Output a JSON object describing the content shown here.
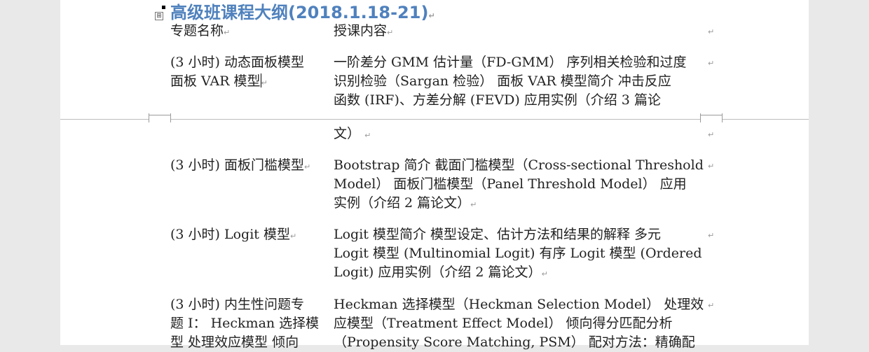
{
  "doc": {
    "heading": "高级班课程大纲(2018.1.18-21)",
    "columns": {
      "topic": "专题名称",
      "content": "授课内容"
    },
    "rows": [
      {
        "topic_lines": [
          "(3 小时) 动态面板模型",
          "面板 VAR 模型"
        ],
        "content_lines": [
          "一阶差分 GMM 估计量（FD-GMM） 序列相关检验和过度",
          "识别检验（Sargan 检验） 面板 VAR 模型简介 冲击反应",
          "函数 (IRF)、方差分解 (FEVD) 应用实例（介绍 3 篇论",
          "文）"
        ]
      },
      {
        "topic_lines": [
          "(3 小时) 面板门槛模型"
        ],
        "content_lines": [
          "Bootstrap 简介 截面门槛模型（Cross-sectional Threshold",
          "Model） 面板门槛模型（Panel Threshold Model） 应用",
          "实例（介绍 2 篇论文）"
        ]
      },
      {
        "topic_lines": [
          "(3 小时) Logit 模型"
        ],
        "content_lines": [
          "Logit 模型简介 模型设定、估计方法和结果的解释 多元",
          "Logit 模型 (Multinomial Logit) 有序 Logit 模型 (Ordered",
          "Logit) 应用实例（介绍 2 篇论文）"
        ]
      },
      {
        "topic_lines": [
          "(3 小时) 内生性问题专",
          "题 I： Heckman 选择模",
          "型 处理效应模型 倾向"
        ],
        "content_lines": [
          "Heckman 选择模型（Heckman Selection Model） 处理效",
          "应模型（Treatment Effect Model） 倾向得分匹配分析",
          "（Propensity Score Matching, PSM） 配对方法：精确配"
        ]
      }
    ],
    "marks": {
      "paragraph": "↵",
      "table_handle": "⊞"
    }
  }
}
